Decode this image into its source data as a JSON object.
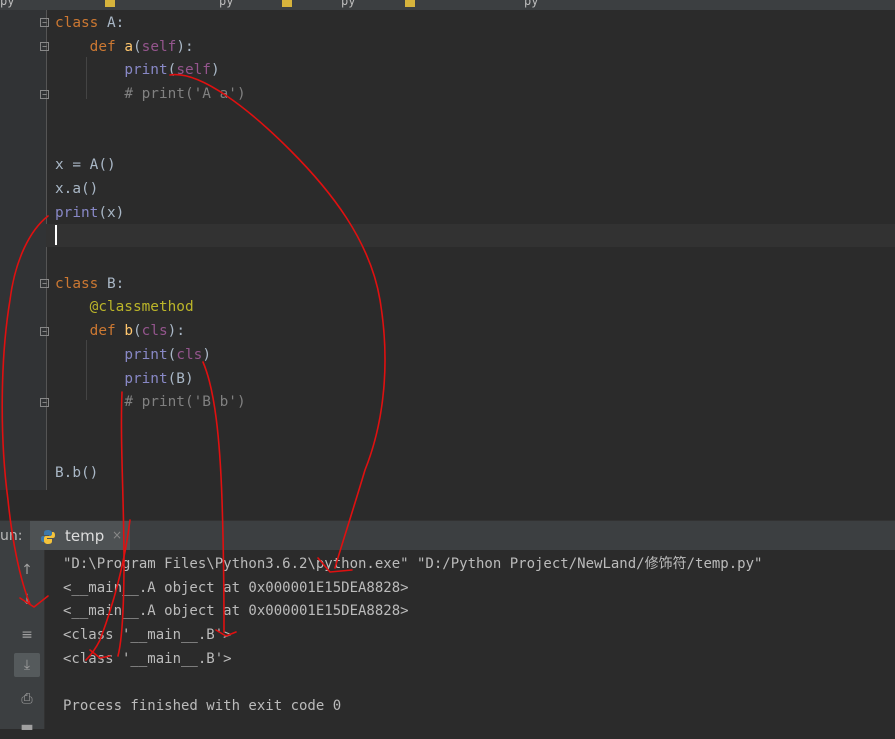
{
  "tabs": [
    {
      "label": "py"
    },
    {
      "label": "py"
    },
    {
      "label": "py"
    },
    {
      "label": "py"
    }
  ],
  "editor": {
    "lines": [
      {
        "tokens": [
          {
            "t": "class ",
            "c": "kw"
          },
          {
            "t": "A:",
            "c": ""
          }
        ]
      },
      {
        "tokens": [
          {
            "t": "    "
          },
          {
            "t": "def ",
            "c": "kw"
          },
          {
            "t": "a",
            "c": "fn"
          },
          {
            "t": "("
          },
          {
            "t": "self",
            "c": "self"
          },
          {
            "t": "):"
          }
        ]
      },
      {
        "tokens": [
          {
            "t": "        "
          },
          {
            "t": "print",
            "c": "bi"
          },
          {
            "t": "("
          },
          {
            "t": "self",
            "c": "self"
          },
          {
            "t": ")"
          }
        ]
      },
      {
        "tokens": [
          {
            "t": "        "
          },
          {
            "t": "# print('A a')",
            "c": "cm"
          }
        ]
      },
      {
        "tokens": []
      },
      {
        "tokens": []
      },
      {
        "tokens": [
          {
            "t": "x = A()"
          }
        ]
      },
      {
        "tokens": [
          {
            "t": "x.a()"
          }
        ]
      },
      {
        "tokens": [
          {
            "t": "print",
            "c": "bi"
          },
          {
            "t": "(x)"
          }
        ]
      },
      {
        "tokens": []
      },
      {
        "tokens": []
      },
      {
        "tokens": [
          {
            "t": "class ",
            "c": "kw"
          },
          {
            "t": "B:"
          }
        ]
      },
      {
        "tokens": [
          {
            "t": "    "
          },
          {
            "t": "@classmethod",
            "c": "dec"
          }
        ]
      },
      {
        "tokens": [
          {
            "t": "    "
          },
          {
            "t": "def ",
            "c": "kw"
          },
          {
            "t": "b",
            "c": "fn"
          },
          {
            "t": "("
          },
          {
            "t": "cls",
            "c": "self"
          },
          {
            "t": "):"
          }
        ]
      },
      {
        "tokens": [
          {
            "t": "        "
          },
          {
            "t": "print",
            "c": "bi"
          },
          {
            "t": "("
          },
          {
            "t": "cls",
            "c": "self"
          },
          {
            "t": ")"
          }
        ]
      },
      {
        "tokens": [
          {
            "t": "        "
          },
          {
            "t": "print",
            "c": "bi"
          },
          {
            "t": "(B)"
          }
        ]
      },
      {
        "tokens": [
          {
            "t": "        "
          },
          {
            "t": "# print('B b')",
            "c": "cm"
          }
        ]
      },
      {
        "tokens": []
      },
      {
        "tokens": []
      },
      {
        "tokens": [
          {
            "t": "B.b()"
          }
        ]
      }
    ]
  },
  "run": {
    "title": "un:",
    "tab_label": "temp",
    "close_glyph": "×"
  },
  "console": {
    "lines": [
      "\"D:\\Program Files\\Python3.6.2\\python.exe\" \"D:/Python Project/NewLand/修饰符/temp.py\"",
      "<__main__.A object at 0x000001E15DEA8828>",
      "<__main__.A object at 0x000001E15DEA8828>",
      "<class '__main__.B'>",
      "<class '__main__.B'>",
      "",
      "Process finished with exit code 0"
    ]
  },
  "colors": {
    "background": "#2b2b2b",
    "keyword": "#cc7832",
    "function": "#ffc66d",
    "self": "#94558d",
    "builtin": "#8888c6",
    "comment": "#808080",
    "decorator": "#bbb529",
    "annotation_ink": "#e01010"
  }
}
